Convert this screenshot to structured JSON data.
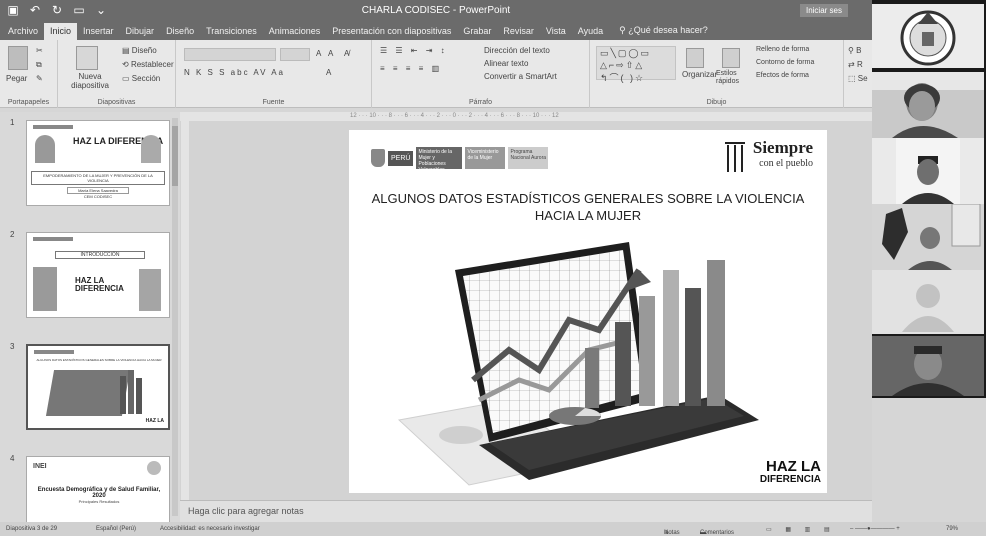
{
  "titlebar": {
    "title": "CHARLA CODISEC - PowerPoint",
    "signin": "Iniciar ses"
  },
  "tabs": [
    {
      "label": "Archivo",
      "active": false
    },
    {
      "label": "Inicio",
      "active": true
    },
    {
      "label": "Insertar",
      "active": false
    },
    {
      "label": "Dibujar",
      "active": false
    },
    {
      "label": "Diseño",
      "active": false
    },
    {
      "label": "Transiciones",
      "active": false
    },
    {
      "label": "Animaciones",
      "active": false
    },
    {
      "label": "Presentación con diapositivas",
      "active": false
    },
    {
      "label": "Grabar",
      "active": false
    },
    {
      "label": "Revisar",
      "active": false
    },
    {
      "label": "Vista",
      "active": false
    },
    {
      "label": "Ayuda",
      "active": false
    }
  ],
  "search": {
    "label": "¿Qué desea hacer?",
    "icon": "lightbulb-icon"
  },
  "ribbon": {
    "clipboard": {
      "paste": "Pegar",
      "label": "Portapapeles"
    },
    "slides": {
      "new_slide": "Nueva diapositiva",
      "layout": "Diseño",
      "reset": "Restablecer",
      "section": "Sección",
      "label": "Diapositivas"
    },
    "font": {
      "label": "Fuente",
      "styles": "N K S S abc AV Aa"
    },
    "paragraph": {
      "label": "Párrafo",
      "text_direction": "Dirección del texto",
      "align_text": "Alinear texto",
      "smartart": "Convertir a SmartArt"
    },
    "drawing": {
      "label": "Dibujo",
      "arrange": "Organizar",
      "quick_styles": "Estilos rápidos",
      "fill": "Relleno de forma",
      "outline": "Contorno de forma",
      "effects": "Efectos de forma"
    },
    "editing": {
      "find": "B",
      "replace": "R",
      "select": "Se"
    }
  },
  "thumbnails": [
    {
      "num": "1",
      "heading": "HAZ LA DIFERENCIA",
      "subtitle": "EMPODERAMIENTO DE LA MUJER Y PREVENCIÓN DE LA VIOLENCIA",
      "author": "María Elena Saavedra",
      "org": "CEM CODISEC"
    },
    {
      "num": "2",
      "heading": "INTRODUCCIÓN",
      "subtitle": "HAZ LA DIFERENCIA"
    },
    {
      "num": "3",
      "heading": "ALGUNOS DATOS ESTADÍSTICOS GENERALES SOBRE LA VIOLENCIA HACIA LA MUJER",
      "badge": "HAZ LA"
    },
    {
      "num": "4",
      "heading": "Encuesta Demográfica y de Salud Familiar, 2020",
      "subtitle": "Principales Resultados",
      "org": "INEI"
    }
  ],
  "slide": {
    "title_line1": "ALGUNOS DATOS ESTADÍSTICOS GENERALES SOBRE LA VIOLENCIA",
    "title_line2": "HACIA LA MUJER",
    "peru": "PERÚ",
    "ministry": "Ministerio de la Mujer y Poblaciones Vulnerables",
    "vice": "Viceministerio de la Mujer",
    "program": "Programa Nacional Aurora",
    "brand1": "Siempre",
    "brand2": "con el pueblo",
    "haz1": "HAZ LA",
    "haz2": "DIFERENCIA"
  },
  "notes_placeholder": "Haga clic para agregar notas",
  "status": {
    "slide_count": "Diapositiva 3 de 29",
    "language": "Español (Perú)",
    "accessibility": "Accesibilidad: es necesario investigar",
    "notes": "Notas",
    "comments": "Comentarios",
    "zoom": "79%"
  },
  "ruler_text": "12 · · · 10 · · · 8 · · · 6 · · · 4 · · · 2 · · · 0 · · · 2 · · · 4 · · · 6 · · · 8 · · · 10 · · · 12",
  "video": {
    "participants": 6
  }
}
